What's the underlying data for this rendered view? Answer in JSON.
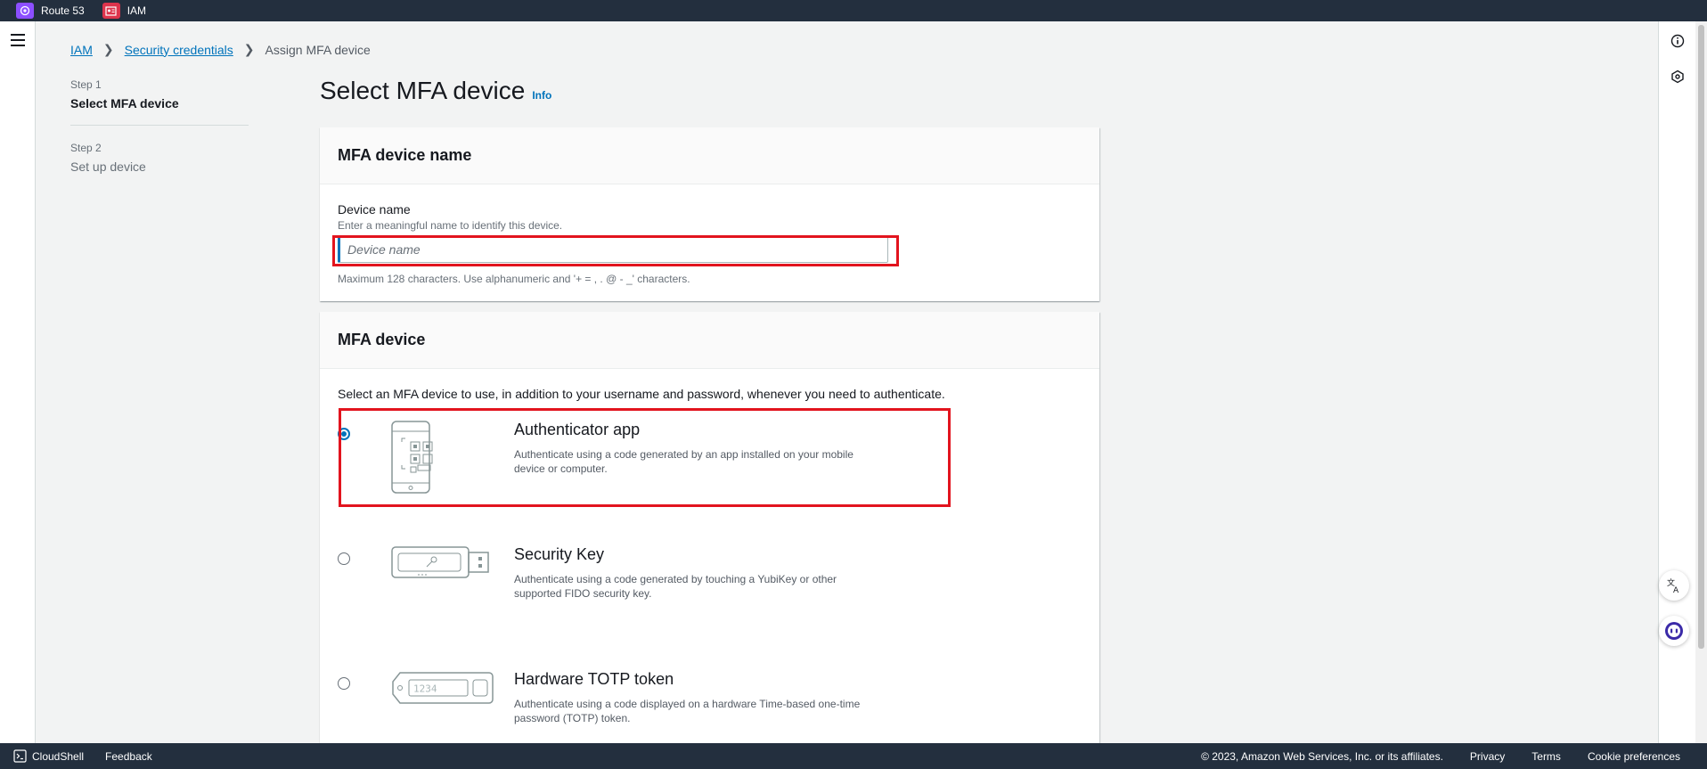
{
  "topbar": {
    "favorites": [
      {
        "label": "Route 53",
        "icon": "route53-icon",
        "color": "#8c4fff"
      },
      {
        "label": "IAM",
        "icon": "iam-icon",
        "color": "#dd344c"
      }
    ]
  },
  "breadcrumb": {
    "items": [
      "IAM",
      "Security credentials"
    ],
    "current": "Assign MFA device"
  },
  "steps": [
    {
      "label": "Step 1",
      "title": "Select MFA device"
    },
    {
      "label": "Step 2",
      "title": "Set up device"
    }
  ],
  "page": {
    "title": "Select MFA device",
    "info": "Info"
  },
  "name_panel": {
    "header": "MFA device name",
    "field_label": "Device name",
    "field_desc": "Enter a meaningful name to identify this device.",
    "placeholder": "Device name",
    "constraint": "Maximum 128 characters. Use alphanumeric and '+ = , . @ - _' characters."
  },
  "device_panel": {
    "header": "MFA device",
    "intro": "Select an MFA device to use, in addition to your username and password, whenever you need to authenticate.",
    "options": [
      {
        "title": "Authenticator app",
        "desc": "Authenticate using a code generated by an app installed on your mobile device or computer.",
        "selected": true
      },
      {
        "title": "Security Key",
        "desc": "Authenticate using a code generated by touching a YubiKey or other supported FIDO security key.",
        "selected": false
      },
      {
        "title": "Hardware TOTP token",
        "desc": "Authenticate using a code displayed on a hardware Time-based one-time password (TOTP) token.",
        "selected": false
      }
    ],
    "token_digits": "1234"
  },
  "footer": {
    "cloudshell": "CloudShell",
    "feedback": "Feedback",
    "copyright": "© 2023, Amazon Web Services, Inc. or its affiliates.",
    "links": [
      "Privacy",
      "Terms",
      "Cookie preferences"
    ]
  },
  "colors": {
    "accent": "#0073bb",
    "highlight": "#e2141e",
    "navbar": "#232f3e"
  }
}
